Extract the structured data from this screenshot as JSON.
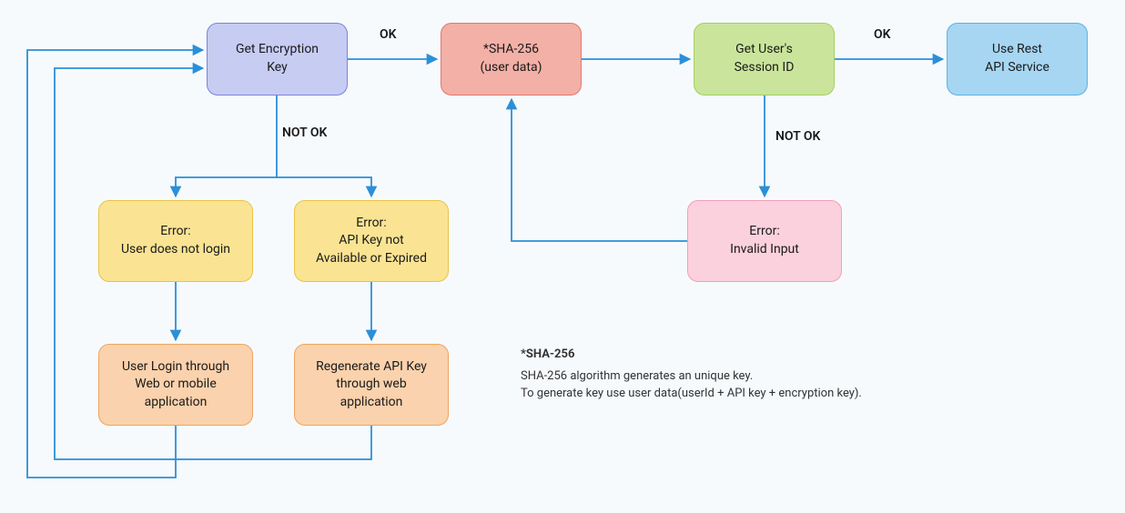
{
  "nodes": {
    "encryption": {
      "line1": "Get Encryption",
      "line2": "Key"
    },
    "sha256": {
      "line1": "*SHA-256",
      "line2": "(user data)"
    },
    "session": {
      "line1": "Get User's",
      "line2": "Session ID"
    },
    "rest": {
      "line1": "Use Rest",
      "line2": "API Service"
    },
    "err_login": {
      "line1": "Error:",
      "line2": "User does not login"
    },
    "err_apikey": {
      "line1": "Error:",
      "line2": "API Key not",
      "line3": "Available or Expired"
    },
    "err_input": {
      "line1": "Error:",
      "line2": "Invalid Input"
    },
    "user_login": {
      "line1": "User Login through",
      "line2": "Web or mobile",
      "line3": "application"
    },
    "regen": {
      "line1": "Regenerate API Key",
      "line2": "through web",
      "line3": "application"
    }
  },
  "labels": {
    "ok1": "OK",
    "ok2": "OK",
    "notok1": "NOT OK",
    "notok2": "NOT OK"
  },
  "note": {
    "title": "*SHA-256",
    "line1": "SHA-256 algorithm generates an unique key.",
    "line2": "To generate key use user data(userId + API key + encryption key)."
  },
  "colors": {
    "arrow": "#2b8fd8"
  }
}
